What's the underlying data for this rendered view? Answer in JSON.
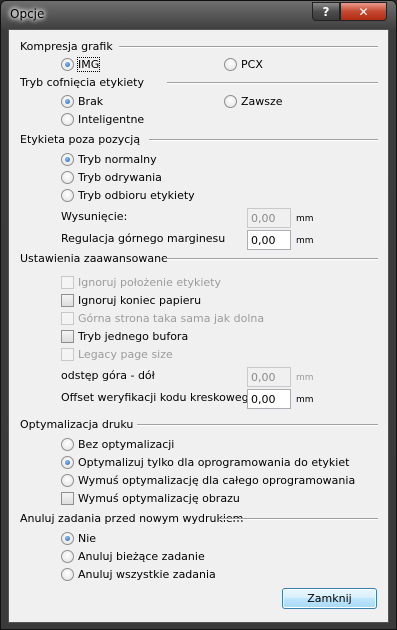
{
  "window": {
    "title": "Opcje",
    "help_glyph": "?",
    "close_glyph": "✕"
  },
  "compression": {
    "title": "Kompresja grafik",
    "options": [
      {
        "label": "IMG",
        "checked": true
      },
      {
        "label": "PCX",
        "checked": false
      }
    ]
  },
  "retract": {
    "title": "Tryb cofnięcia etykiety",
    "options": [
      {
        "label": "Brak",
        "checked": true
      },
      {
        "label": "Zawsze",
        "checked": false
      },
      {
        "label": "Inteligentne",
        "checked": false
      }
    ]
  },
  "out_of_position": {
    "title": "Etykieta poza pozycją",
    "options": [
      {
        "label": "Tryb normalny",
        "checked": true
      },
      {
        "label": "Tryb odrywania",
        "checked": false
      },
      {
        "label": "Tryb odbioru etykiety",
        "checked": false
      }
    ],
    "extension_label": "Wysunięcie:",
    "extension_value": "0,00",
    "extension_unit": "mm",
    "top_margin_label": "Regulacja górnego marginesu",
    "top_margin_value": "0,00",
    "top_margin_unit": "mm"
  },
  "advanced": {
    "title": "Ustawienia zaawansowane",
    "checks": [
      {
        "label": "Ignoruj położenie etykiety",
        "checked": false,
        "enabled": false
      },
      {
        "label": "Ignoruj koniec papieru",
        "checked": false,
        "enabled": true
      },
      {
        "label": "Górna strona taka sama jak dolna",
        "checked": false,
        "enabled": false
      },
      {
        "label": "Tryb jednego bufora",
        "checked": false,
        "enabled": true
      },
      {
        "label": "Legacy page size",
        "checked": false,
        "enabled": false
      }
    ],
    "gap_label": "odstęp góra - dół",
    "gap_value": "0,00",
    "gap_unit": "mm",
    "barcode_label": "Offset weryfikacji kodu kreskowego",
    "barcode_value": "0,00",
    "barcode_unit": "mm"
  },
  "print_opt": {
    "title": "Optymalizacja druku",
    "options": [
      {
        "label": "Bez optymalizacji",
        "checked": false
      },
      {
        "label": "Optymalizuj tylko dla oprogramowania do etykiet",
        "checked": true
      },
      {
        "label": "Wymuś optymalizację dla całego oprogramowania",
        "checked": false
      }
    ],
    "force_image_label": "Wymuś optymalizację obrazu"
  },
  "cancel_jobs": {
    "title": "Anuluj zadania przed nowym wydrukiem",
    "options": [
      {
        "label": "Nie",
        "checked": true
      },
      {
        "label": "Anuluj bieżące zadanie",
        "checked": false
      },
      {
        "label": "Anuluj wszystkie zadania",
        "checked": false
      }
    ]
  },
  "close_button": "Zamknij"
}
